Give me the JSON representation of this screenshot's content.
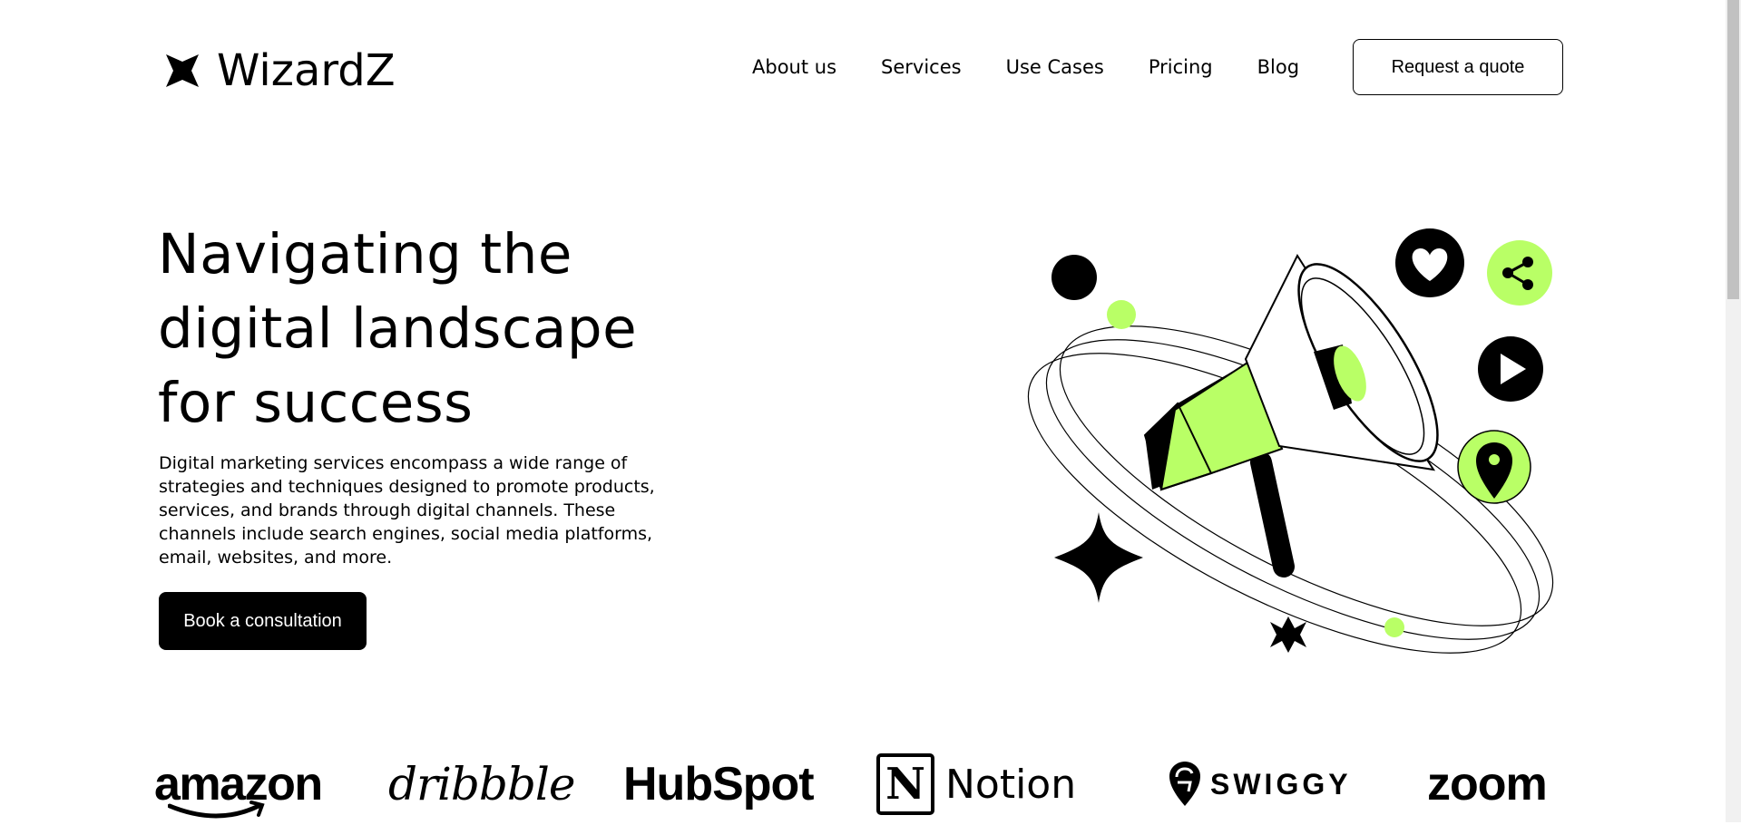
{
  "header": {
    "logo_text": "WizardZ",
    "logo_icon": "four-point-star-icon",
    "nav": [
      {
        "label": "About us"
      },
      {
        "label": "Services"
      },
      {
        "label": "Use Cases"
      },
      {
        "label": "Pricing"
      },
      {
        "label": "Blog"
      }
    ],
    "quote_button": "Request a quote"
  },
  "hero": {
    "title": "Navigating the digital landscape for success",
    "description": "Digital marketing services encompass a wide range of strategies and techniques designed to promote products, services, and brands through digital channels. These channels include search engines, social media platforms, email, websites, and more.",
    "cta": "Book a consultation",
    "illustration_icons": [
      "megaphone-icon",
      "heart-icon",
      "share-icon",
      "play-icon",
      "location-pin-icon",
      "sparkle-icon",
      "star-icon"
    ]
  },
  "brands": {
    "amazon": "amazon",
    "dribbble": "dribbble",
    "hubspot": "HubSpot",
    "notion": "Notion",
    "notion_mark": "N",
    "swiggy": "SWIGGY",
    "zoom": "zoom"
  },
  "colors": {
    "accent": "#B9FF66",
    "dark": "#000000",
    "background": "#FFFFFF"
  }
}
